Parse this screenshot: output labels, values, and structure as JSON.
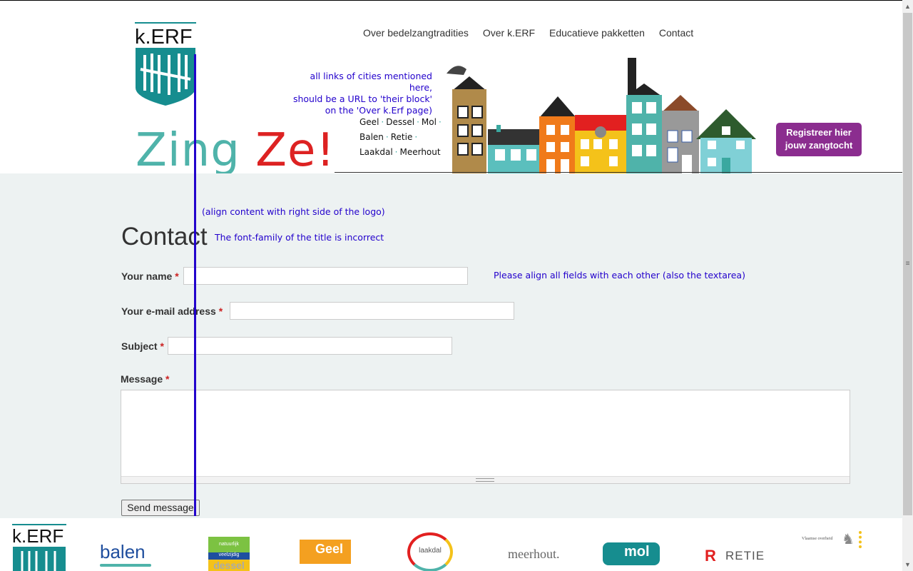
{
  "nav": {
    "items": [
      "Over bedelzangtradities",
      "Over k.ERF",
      "Educatieve pakketten",
      "Contact"
    ]
  },
  "logo": {
    "text": "k.ERF"
  },
  "zing": {
    "part1": "Zing",
    "part2": "Ze!"
  },
  "annotations": {
    "links_line1": "all links of cities mentioned here,",
    "links_line2": "should be a URL to 'their block'",
    "links_line3": "on the 'Over k.Erf page)",
    "align_logo": "(align content with right side of the logo)",
    "font_family": "The font-family of the title is incorrect",
    "align_fields": "Please align all fields with each other (also the textarea)"
  },
  "cities": {
    "row1": [
      "Geel",
      "Dessel",
      "Mol"
    ],
    "row2": [
      "Balen",
      "Retie"
    ],
    "row3": [
      "Laakdal",
      "Meerhout"
    ]
  },
  "register": {
    "line1": "Registreer hier",
    "line2": "jouw zangtocht"
  },
  "form": {
    "title": "Contact",
    "name_label": "Your name",
    "email_label": "Your e-mail address",
    "subject_label": "Subject",
    "message_label": "Message",
    "required_mark": "*",
    "send_label": "Send message"
  },
  "footer": {
    "balen": "balen",
    "geel": "Geel",
    "laakdal": "laakdal",
    "meerhout": "meerhout.",
    "mol": "mol",
    "retie": "RETIE",
    "vlaamse": "Vlaamse overheid",
    "dessel_top": "natuurlijk",
    "dessel_mid": "veelzijdig",
    "dessel_name": "dessel"
  },
  "colors": {
    "teal": "#168d8f",
    "register_purple": "#8b2d8f",
    "annotation_blue": "#2200cc",
    "main_bg": "#edf2f2"
  }
}
